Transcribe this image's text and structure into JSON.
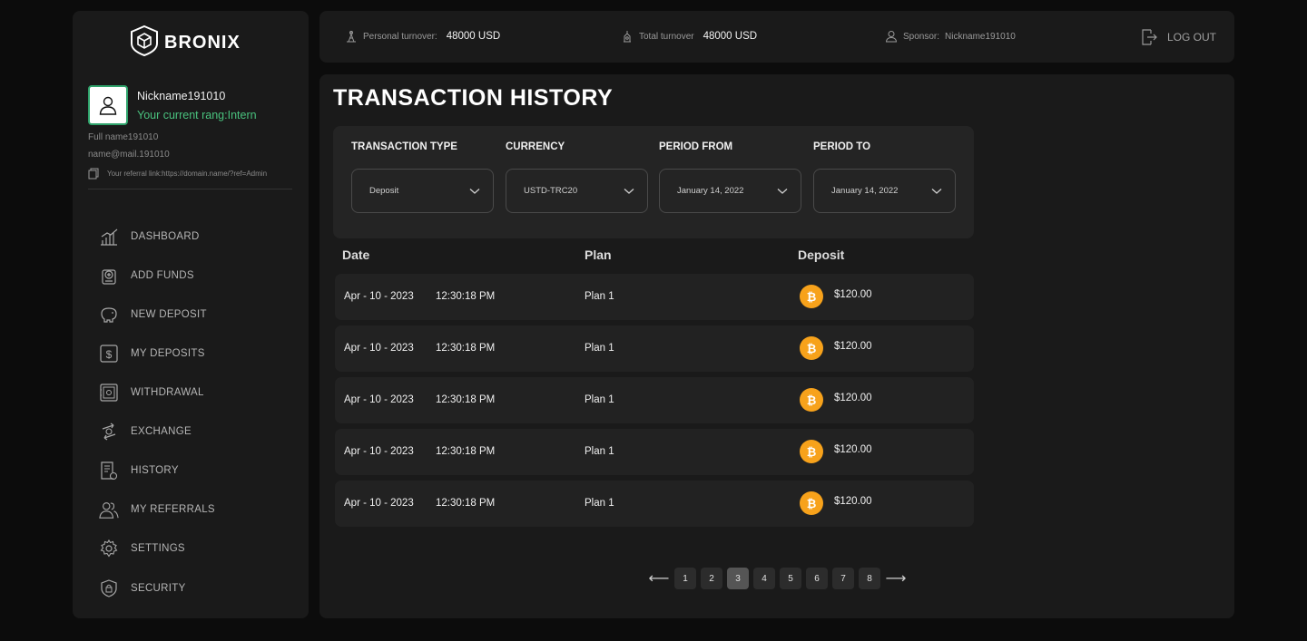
{
  "brand": {
    "name": "BRONIX"
  },
  "profile": {
    "nickname": "Nickname191010",
    "rang": "Your current rang:Intern",
    "full_name": "Full name191010",
    "email": "name@mail.191010",
    "referral": "Your referral link:https://domain.name/?ref=Admin"
  },
  "nav": {
    "items": [
      {
        "label": "DASHBOARD",
        "icon": "chart-icon"
      },
      {
        "label": "ADD FUNDS",
        "icon": "wallet-plus-icon"
      },
      {
        "label": "NEW DEPOSIT",
        "icon": "piggy-bank-icon"
      },
      {
        "label": "MY DEPOSITS",
        "icon": "dollar-icon"
      },
      {
        "label": "WITHDRAWAL",
        "icon": "safe-icon"
      },
      {
        "label": "EXCHANGE",
        "icon": "exchange-icon"
      },
      {
        "label": "HISTORY",
        "icon": "history-icon"
      },
      {
        "label": "MY REFERRALS",
        "icon": "users-icon"
      },
      {
        "label": "SETTINGS",
        "icon": "gear-icon"
      },
      {
        "label": "SECURITY",
        "icon": "shield-icon"
      }
    ]
  },
  "topbar": {
    "personal_label": "Personal turnover:",
    "personal_value": "48000 USD",
    "total_label": "Total turnover",
    "total_value": "48000 USD",
    "sponsor_label": "Sponsor:",
    "sponsor_value": "Nickname191010",
    "logout_label": "LOG OUT"
  },
  "main": {
    "title": "TRANSACTION HISTORY",
    "filters": [
      {
        "label": "TRANSACTION TYPE",
        "value": "Deposit"
      },
      {
        "label": "CURRENCY",
        "value": "USTD-TRC20"
      },
      {
        "label": "PERIOD FROM",
        "value": "January 14, 2022"
      },
      {
        "label": "PERIOD TO",
        "value": "January 14, 2022"
      }
    ],
    "columns": [
      "Date",
      "Plan",
      "Deposit"
    ],
    "rows": [
      {
        "date": "Apr - 10 - 2023",
        "time": "12:30:18 PM",
        "plan": "Plan 1",
        "amount": "$120.00"
      },
      {
        "date": "Apr - 10 - 2023",
        "time": "12:30:18 PM",
        "plan": "Plan 1",
        "amount": "$120.00"
      },
      {
        "date": "Apr - 10 - 2023",
        "time": "12:30:18 PM",
        "plan": "Plan 1",
        "amount": "$120.00"
      },
      {
        "date": "Apr - 10 - 2023",
        "time": "12:30:18 PM",
        "plan": "Plan 1",
        "amount": "$120.00"
      },
      {
        "date": "Apr - 10 - 2023",
        "time": "12:30:18 PM",
        "plan": "Plan 1",
        "amount": "$120.00"
      }
    ],
    "pagination": {
      "pages": [
        "1",
        "2",
        "3",
        "4",
        "5",
        "6",
        "7",
        "8"
      ],
      "current": "3",
      "prev": "⟵",
      "next": "⟶"
    }
  },
  "colors": {
    "accent_green": "#49c27e",
    "bitcoin_orange": "#f7a21b",
    "panel": "#1a1a1a",
    "background": "#0c0c0c"
  }
}
